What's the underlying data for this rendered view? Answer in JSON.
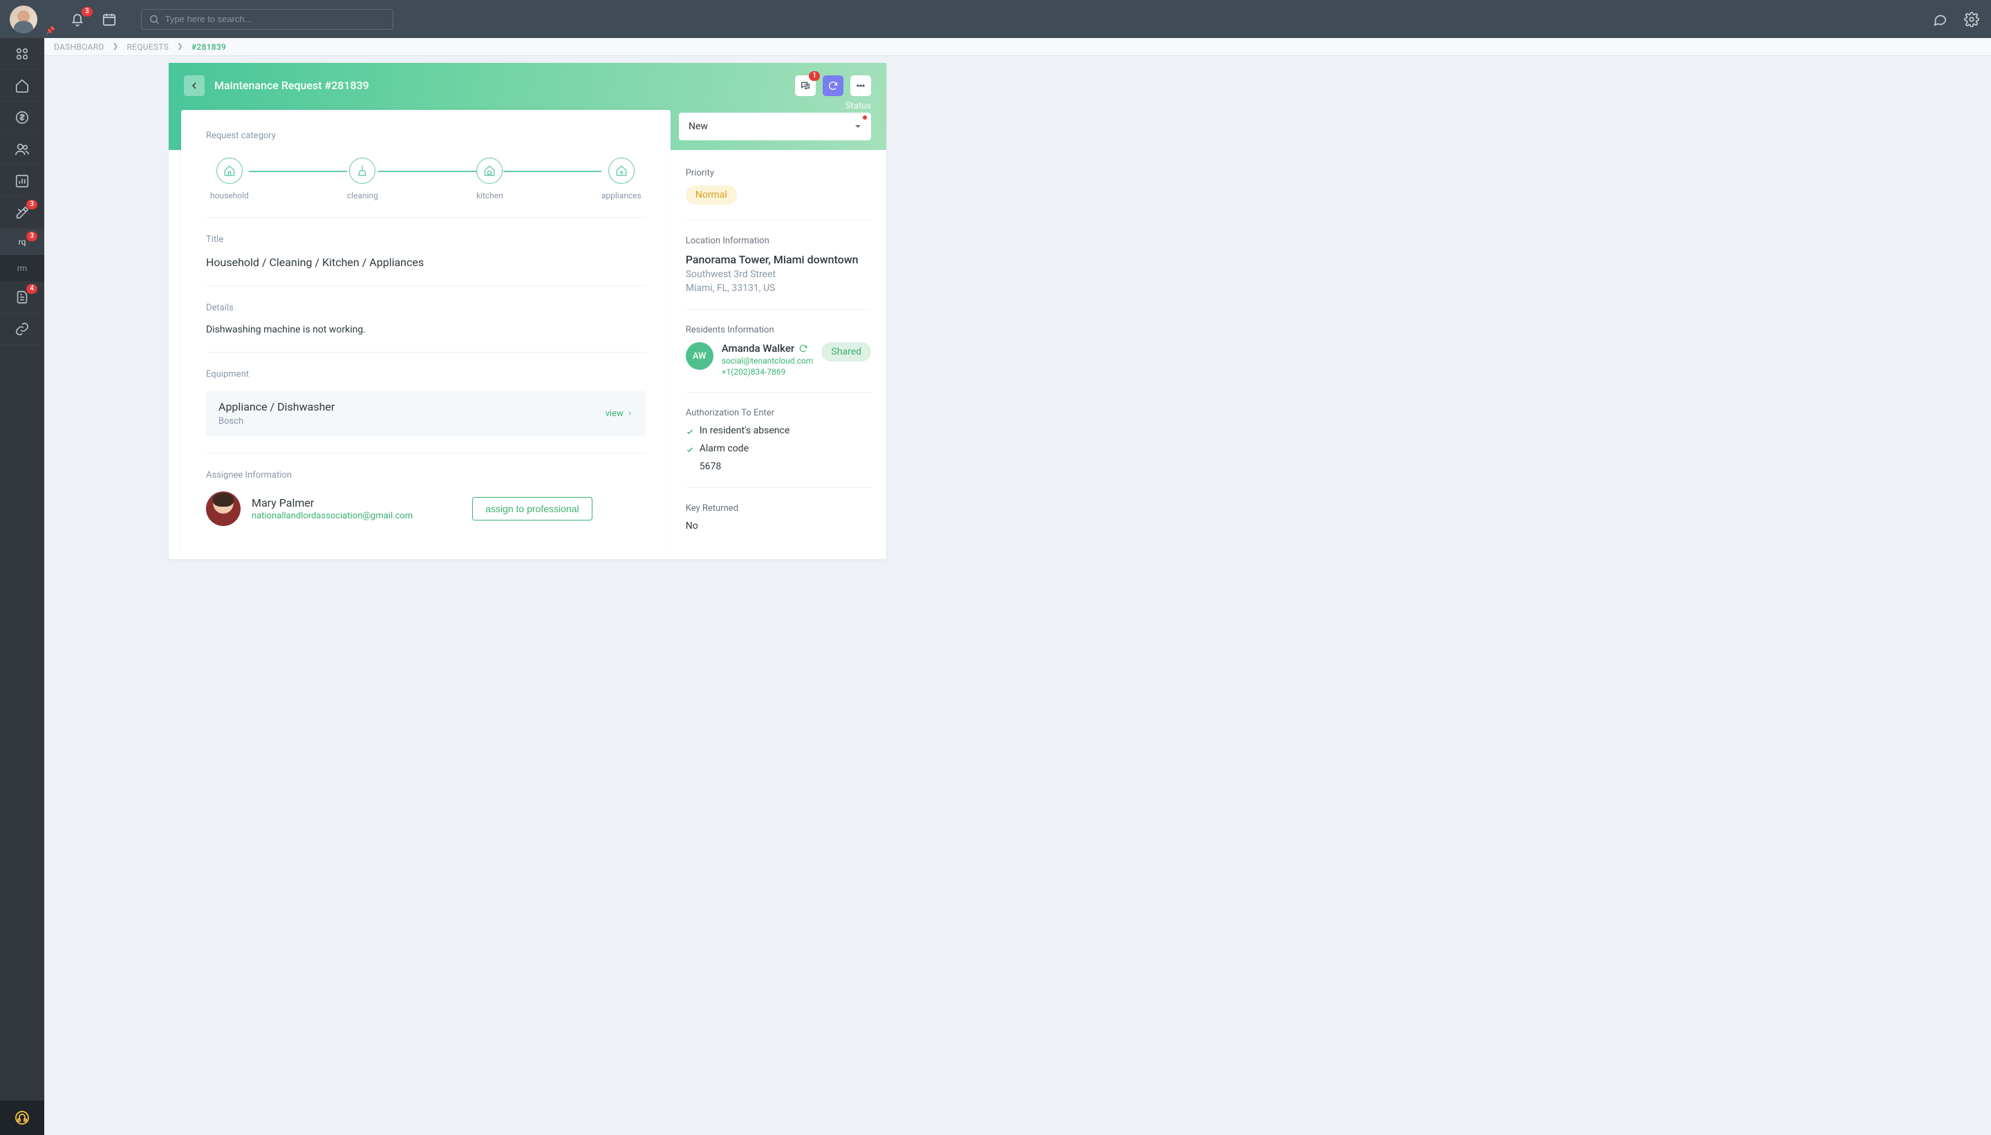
{
  "topbar": {
    "notifications_badge": "3",
    "search_placeholder": "Type here to search..."
  },
  "sidebar": {
    "tools_badge": "3",
    "rq_label": "rq",
    "rq_badge": "3",
    "rm_label": "rm",
    "doc_badge": "4"
  },
  "breadcrumb": {
    "dashboard": "DASHBOARD",
    "requests": "REQUESTS",
    "current": "#281839"
  },
  "header": {
    "title": "Maintenance Request #281839",
    "chat_badge": "1",
    "status_label": "Status",
    "status_value": "New"
  },
  "request": {
    "category_label": "Request category",
    "categories": {
      "c1": "household",
      "c2": "cleaning",
      "c3": "kitchen",
      "c4": "appliances"
    },
    "title_label": "Title",
    "title_value": "Household / Cleaning / Kitchen / Appliances",
    "details_label": "Details",
    "details_value": "Dishwashing machine is not working.",
    "equipment_label": "Equipment",
    "equipment": {
      "name": "Appliance / Dishwasher",
      "brand": "Bosch",
      "view": "view"
    },
    "assignee_label": "Assignee Information",
    "assignee": {
      "name": "Mary Palmer",
      "email": "nationallandlordassociation@gmail.com",
      "assign_btn": "assign to professional"
    }
  },
  "side_panel": {
    "priority_label": "Priority",
    "priority_value": "Normal",
    "location_label": "Location Information",
    "location": {
      "name": "Panorama Tower, Miami downtown",
      "street": "Southwest 3rd Street",
      "city": "Miami, FL, 33131, US"
    },
    "residents_label": "Residents Information",
    "resident": {
      "initials": "AW",
      "name": "Amanda Walker",
      "email": "social@tenantcloud.com",
      "phone": "+1(202)834-7869",
      "shared": "Shared"
    },
    "auth_label": "Authorization To Enter",
    "auth_absence": "In resident's absence",
    "auth_alarm": "Alarm code",
    "auth_alarm_code": "5678",
    "key_label": "Key Returned",
    "key_value": "No"
  }
}
